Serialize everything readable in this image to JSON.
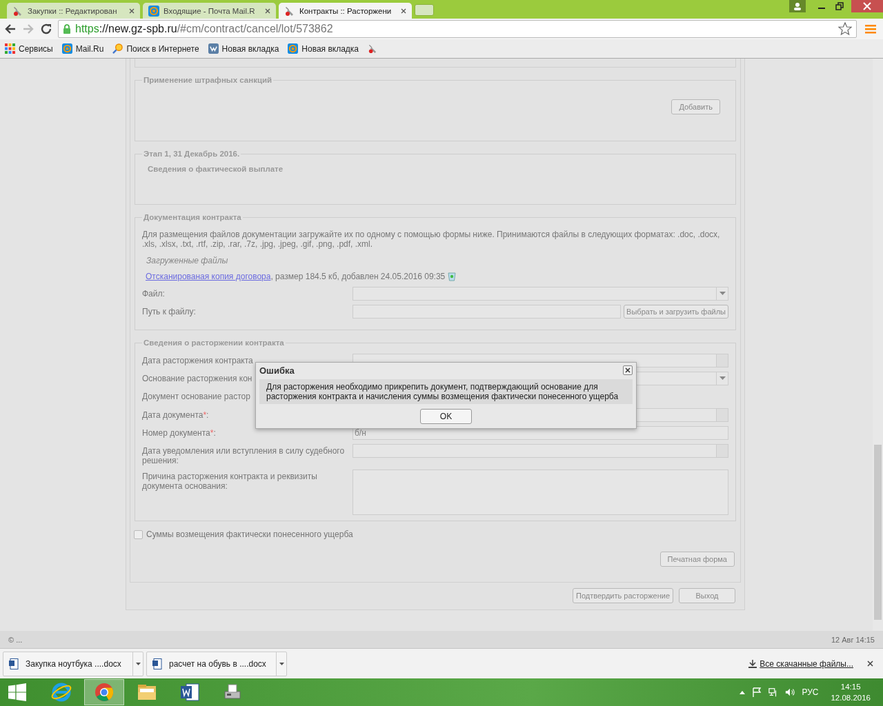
{
  "browser": {
    "tabs": [
      {
        "title": "Закупки :: Редактирован",
        "kind": "tool",
        "selected": false
      },
      {
        "title": "Входящие - Почта Mail.R",
        "kind": "mail",
        "selected": false
      },
      {
        "title": "Контракты :: Расторжени",
        "kind": "tool",
        "selected": true
      }
    ],
    "url": {
      "scheme": "https",
      "host": "://new.gz-spb.ru",
      "path": "/#cm/contract/cancel/lot/573862"
    },
    "bookmarks": [
      {
        "label": "Сервисы",
        "kind": "apps"
      },
      {
        "label": "Mail.Ru",
        "kind": "mail"
      },
      {
        "label": "Поиск в Интернете",
        "kind": "search"
      },
      {
        "label": "Новая вкладка",
        "kind": "vk"
      },
      {
        "label": "Новая вкладка",
        "kind": "mail"
      },
      {
        "kind": "tool"
      }
    ]
  },
  "page": {
    "sections": [
      {
        "kind": "penalty",
        "title": "Применение штрафных санкций",
        "button": "Добавить"
      },
      {
        "kind": "stage",
        "title": "Этап 1, 31 Декабрь 2016.",
        "subtitle": "Сведения о фактической выплате"
      },
      {
        "kind": "docs",
        "title": "Документация контракта",
        "description": "Для размещения файлов документации загружайте их по одному с помощью формы ниже. Принимаются файлы в следующих форматах: .doc, .docx, .xls, .xlsx, .txt, .rtf, .zip, .rar, .7z, .jpg, .jpeg, .gif, .png, .pdf, .xml.",
        "files_label": "Загруженные файлы",
        "file": {
          "link": "Отсканированая копия договора",
          "details": ", размер 184.5 кб, добавлен 24.05.2016 09:35"
        },
        "rows": [
          {
            "label": "Файл:",
            "kind": "select"
          },
          {
            "label": "Путь к файлу:",
            "kind": "upload",
            "button": "Выбрать и загрузить файлы"
          }
        ]
      },
      {
        "kind": "form",
        "title": "Сведения о расторжении контракта",
        "rows": [
          {
            "label": "Дата расторжения контракта",
            "kind": "date"
          },
          {
            "label": "Основание расторжения кон",
            "kind": "select"
          },
          {
            "label": "Документ основание растор",
            "kind": "none"
          },
          {
            "label": "Дата документа",
            "kind": "date",
            "asterisk": "*",
            "colon": ":"
          },
          {
            "label": "Номер документа",
            "kind": "text",
            "asterisk": "*",
            "colon": ":",
            "value": "б/н"
          },
          {
            "label": "Дата уведомления или вступления в силу судебного решения:",
            "kind": "date"
          },
          {
            "label": "Причина расторжения контракта и реквизиты документа основания:",
            "kind": "textarea"
          }
        ]
      }
    ],
    "damages_checkbox": {
      "label": "Суммы возмещения фактически понесенного ущерба",
      "checked": false
    },
    "print_button": "Печатная форма",
    "buttons": [
      "Подтвердить расторжение",
      "Выход"
    ]
  },
  "dialog": {
    "title": "Ошибка",
    "message": "Для расторжения необходимо прикрепить документ, подтверждающий основание для расторжения контракта и начисления суммы возмещения фактически понесенного ущерба",
    "ok": "OK"
  },
  "status_bar": {
    "left": "© ...",
    "right": "12 Авг 14:15"
  },
  "downloads": {
    "items": [
      {
        "name": "Закупка ноутбука ....docx"
      },
      {
        "name": "расчет на обувь в ....docx"
      }
    ],
    "show_all": "Все скачанные файлы..."
  },
  "taskbar": {
    "apps": [
      {
        "kind": "ie",
        "selected": false
      },
      {
        "kind": "chrome",
        "selected": true
      },
      {
        "kind": "folder",
        "selected": false
      },
      {
        "kind": "word",
        "selected": false
      },
      {
        "kind": "fax",
        "selected": false
      }
    ],
    "language": "РУС",
    "time": "14:15",
    "date": "12.08.2016"
  }
}
